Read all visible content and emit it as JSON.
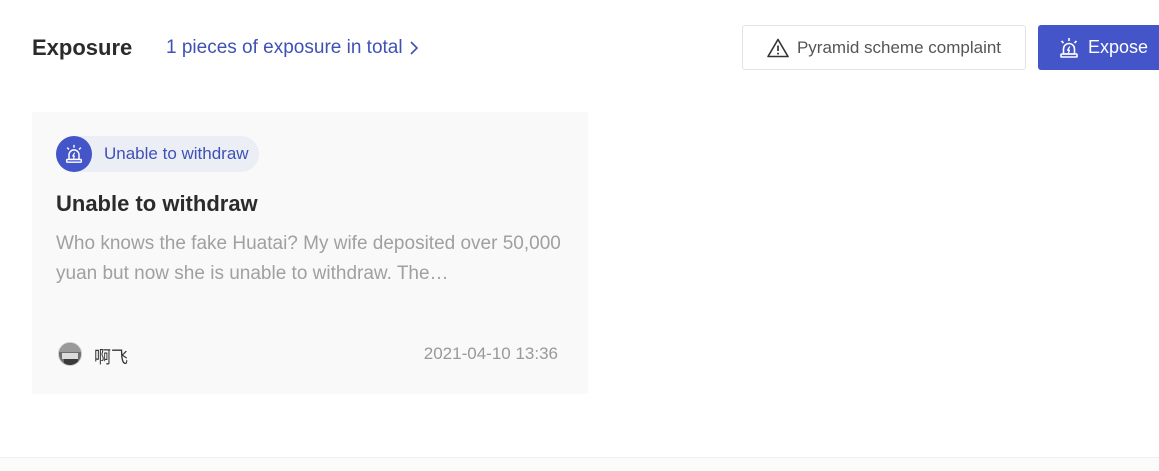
{
  "header": {
    "title": "Exposure",
    "total_link": "1 pieces of exposure in total",
    "complaint_button": "Pyramid scheme complaint",
    "expose_button": "Expose"
  },
  "icons": {
    "chevron": "chevron-right-icon",
    "warning": "warning-triangle-icon",
    "alarm": "alarm-siren-icon",
    "avatar": "user-avatar"
  },
  "colors": {
    "accent": "#4355c8",
    "link": "#3f51b5",
    "card_bg": "#f9f9f9",
    "muted_text": "#a0a0a0"
  },
  "exposures": [
    {
      "tag": "Unable to withdraw",
      "title": "Unable to withdraw",
      "description": "Who knows the fake Huatai? My wife deposited over 50,000 yuan but now she is unable to withdraw. The…",
      "author": "啊飞",
      "time": "2021-04-10 13:36"
    }
  ]
}
